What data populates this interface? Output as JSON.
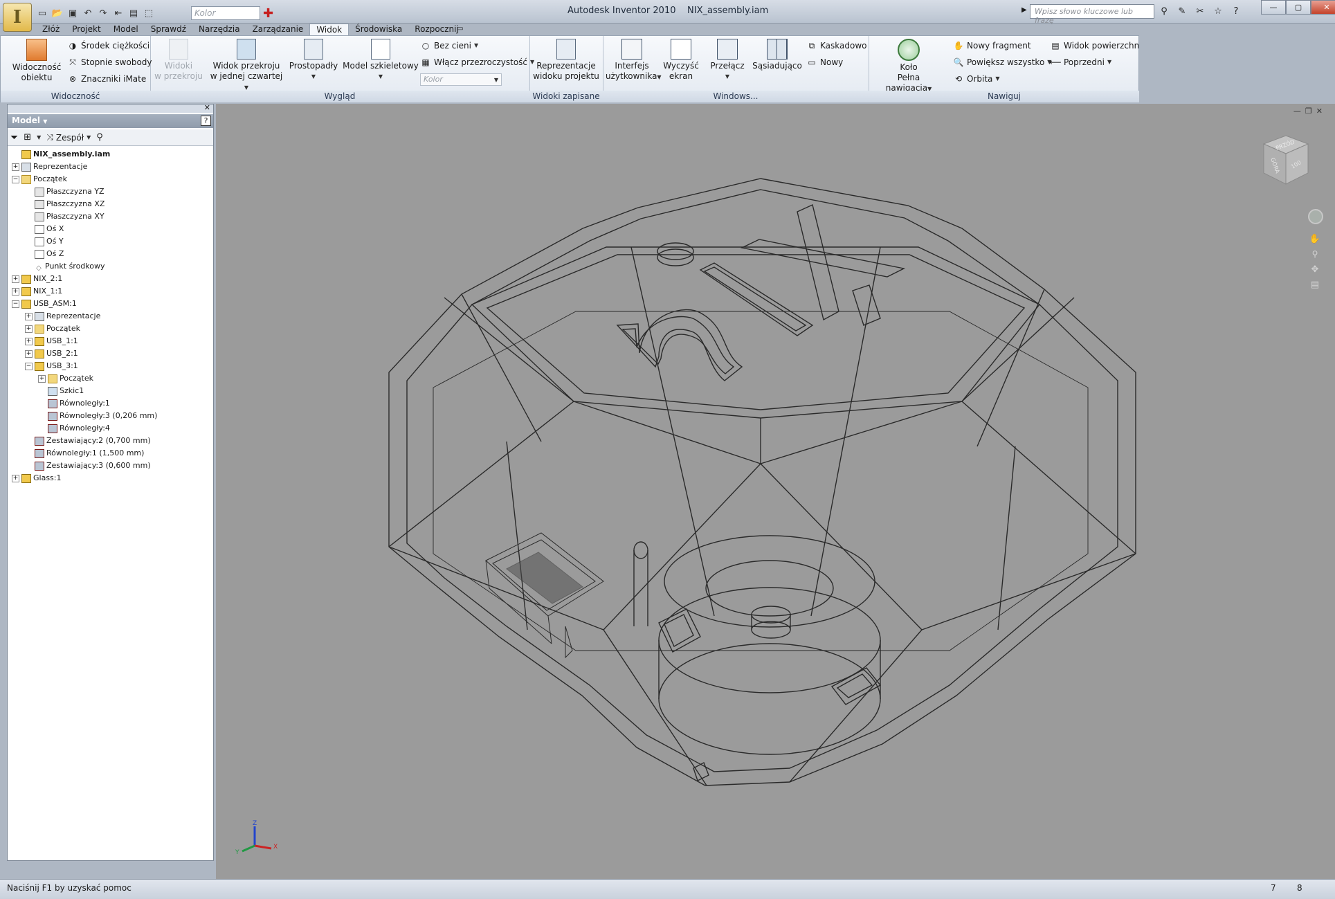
{
  "title": {
    "app": "Autodesk Inventor 2010",
    "document": "NIX_assembly.iam"
  },
  "qat": {
    "color_placeholder": "Kolor"
  },
  "search": {
    "placeholder": "Wpisz słowo kluczowe lub frazę"
  },
  "tabs": [
    "Złóż",
    "Projekt",
    "Model",
    "Sprawdź",
    "Narzędzia",
    "Zarządzanie",
    "Widok",
    "Środowiska",
    "Rozpocznij"
  ],
  "active_tab": "Widok",
  "ribbon": {
    "widocznosc": {
      "title": "Widoczność",
      "obj_vis_line1": "Widoczność",
      "obj_vis_line2": "obiektu",
      "center_gravity": "Środek ciężkości",
      "dof": "Stopnie swobody",
      "imate": "Znaczniki iMate"
    },
    "wyglad": {
      "title": "Wygląd",
      "section_views_1": "Widoki",
      "section_views_2": "w przekroju",
      "quarter_1": "Widok przekroju",
      "quarter_2": "w jednej czwartej",
      "ortho": "Prostopadły",
      "wireframe": "Model szkieletowy",
      "no_shadow": "Bez cieni",
      "transparency": "Włącz przezroczystość",
      "color": "Kolor"
    },
    "widoki_zapisane": {
      "title": "Widoki zapisane",
      "rep_1": "Reprezentacje",
      "rep_2": "widoku projektu"
    },
    "windows": {
      "title": "Windows...",
      "ui_1": "Interfejs",
      "ui_2": "użytkownika",
      "clear_1": "Wyczyść",
      "clear_2": "ekran",
      "switch": "Przełącz",
      "tile": "Sąsiadująco",
      "cascade": "Kaskadowo",
      "new": "Nowy"
    },
    "nawiguj": {
      "title": "Nawiguj",
      "wheel_1": "Koło",
      "wheel_2": "Pełna nawigacja",
      "new_fragment": "Nowy fragment",
      "zoom_all": "Powiększ wszystko",
      "orbit": "Orbita",
      "surface_view": "Widok powierzchni",
      "previous": "Poprzedni"
    }
  },
  "browser": {
    "header": "Model",
    "filter_label": "Zespół",
    "help": "?",
    "tree": [
      {
        "label": "NIX_assembly.iam",
        "depth": 0,
        "icon": "part",
        "expander": "",
        "bold": true
      },
      {
        "label": "Reprezentacje",
        "depth": 0,
        "icon": "rep",
        "expander": "+"
      },
      {
        "label": "Początek",
        "depth": 0,
        "icon": "folder",
        "expander": "-"
      },
      {
        "label": "Płaszczyzna YZ",
        "depth": 1,
        "icon": "plane",
        "expander": ""
      },
      {
        "label": "Płaszczyzna XZ",
        "depth": 1,
        "icon": "plane",
        "expander": ""
      },
      {
        "label": "Płaszczyzna XY",
        "depth": 1,
        "icon": "plane",
        "expander": ""
      },
      {
        "label": "Oś X",
        "depth": 1,
        "icon": "axis",
        "expander": ""
      },
      {
        "label": "Oś Y",
        "depth": 1,
        "icon": "axis",
        "expander": ""
      },
      {
        "label": "Oś Z",
        "depth": 1,
        "icon": "axis",
        "expander": ""
      },
      {
        "label": "Punkt środkowy",
        "depth": 1,
        "icon": "point",
        "expander": ""
      },
      {
        "label": "NIX_2:1",
        "depth": 0,
        "icon": "part",
        "expander": "+"
      },
      {
        "label": "NIX_1:1",
        "depth": 0,
        "icon": "part",
        "expander": "+"
      },
      {
        "label": "USB_ASM:1",
        "depth": 0,
        "icon": "part",
        "expander": "-"
      },
      {
        "label": "Reprezentacje",
        "depth": 1,
        "icon": "rep",
        "expander": "+"
      },
      {
        "label": "Początek",
        "depth": 1,
        "icon": "folder",
        "expander": "+"
      },
      {
        "label": "USB_1:1",
        "depth": 1,
        "icon": "part",
        "expander": "+"
      },
      {
        "label": "USB_2:1",
        "depth": 1,
        "icon": "part",
        "expander": "+"
      },
      {
        "label": "USB_3:1",
        "depth": 1,
        "icon": "part",
        "expander": "-"
      },
      {
        "label": "Początek",
        "depth": 2,
        "icon": "folder",
        "expander": "+"
      },
      {
        "label": "Szkic1",
        "depth": 2,
        "icon": "sketch",
        "expander": ""
      },
      {
        "label": "Równoległy:1",
        "depth": 2,
        "icon": "constraint",
        "expander": ""
      },
      {
        "label": "Równoległy:3 (0,206 mm)",
        "depth": 2,
        "icon": "constraint",
        "expander": ""
      },
      {
        "label": "Równoległy:4",
        "depth": 2,
        "icon": "constraint",
        "expander": ""
      },
      {
        "label": "Zestawiający:2 (0,700 mm)",
        "depth": 1,
        "icon": "constraint",
        "expander": ""
      },
      {
        "label": "Równoległy:1 (1,500 mm)",
        "depth": 1,
        "icon": "constraint",
        "expander": ""
      },
      {
        "label": "Zestawiający:3 (0,600 mm)",
        "depth": 1,
        "icon": "constraint",
        "expander": ""
      },
      {
        "label": "Glass:1",
        "depth": 0,
        "icon": "part",
        "expander": "+"
      }
    ]
  },
  "viewcube": {
    "face_top": "PRZÓD",
    "face_left": "GÓRA",
    "face_right": "100"
  },
  "axis": {
    "x": "X",
    "y": "Y",
    "z": "Z"
  },
  "status": {
    "text": "Naciśnij F1 by uzyskać pomoc",
    "n1": "7",
    "n2": "8"
  }
}
